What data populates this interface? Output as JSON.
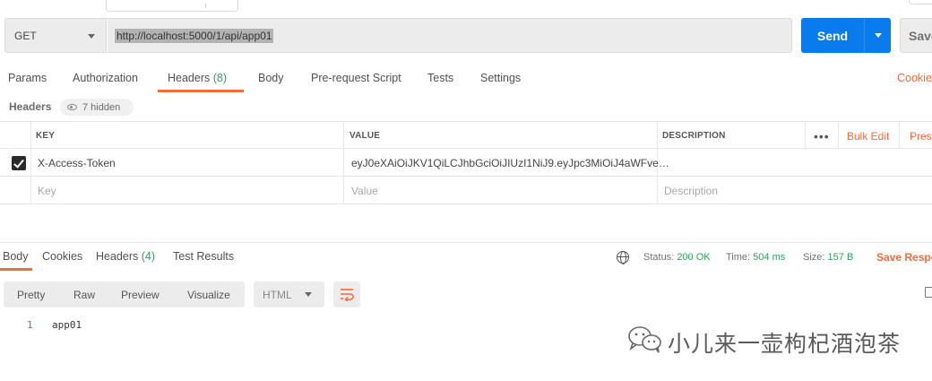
{
  "request": {
    "method": "GET",
    "url": "http://localhost:5000/1/api/app01",
    "send_label": "Send",
    "save_label": "Save"
  },
  "request_tabs": [
    {
      "label": "Params"
    },
    {
      "label": "Authorization"
    },
    {
      "label": "Headers",
      "count": "(8)",
      "active": true
    },
    {
      "label": "Body"
    },
    {
      "label": "Pre-request Script"
    },
    {
      "label": "Tests"
    },
    {
      "label": "Settings"
    }
  ],
  "cookies_link": "Cookies",
  "headers_section": {
    "label": "Headers",
    "hidden_label": "7 hidden"
  },
  "headers_table": {
    "columns": [
      "KEY",
      "VALUE",
      "DESCRIPTION"
    ],
    "bulk_edit_label": "Bulk Edit",
    "presets_label": "Presets",
    "rows": [
      {
        "checked": true,
        "key": "X-Access-Token",
        "value": "eyJ0eXAiOiJKV1QiLCJhbGciOiJIUzI1NiJ9.eyJpc3MiOiJ4aWFve…",
        "description": ""
      }
    ],
    "placeholder": {
      "key": "Key",
      "value": "Value",
      "description": "Description"
    }
  },
  "response_tabs": [
    {
      "label": "Body",
      "active": true
    },
    {
      "label": "Cookies"
    },
    {
      "label": "Headers",
      "count": "(4)"
    },
    {
      "label": "Test Results"
    }
  ],
  "response_status": {
    "status_label": "Status:",
    "status_value": "200 OK",
    "time_label": "Time:",
    "time_value": "504 ms",
    "size_label": "Size:",
    "size_value": "157 B",
    "save_response_label": "Save Response"
  },
  "body_view": {
    "buttons": [
      "Pretty",
      "Raw",
      "Preview",
      "Visualize"
    ],
    "format": "HTML"
  },
  "response_body": {
    "lines": [
      {
        "no": "1",
        "text": "app01"
      }
    ]
  },
  "watermark": {
    "text": "小儿来一壶枸杞酒泡茶",
    "icon": "wechat-icon"
  },
  "colors": {
    "accent": "#f26b3a",
    "primary": "#097bed",
    "success": "#2aa35a"
  }
}
